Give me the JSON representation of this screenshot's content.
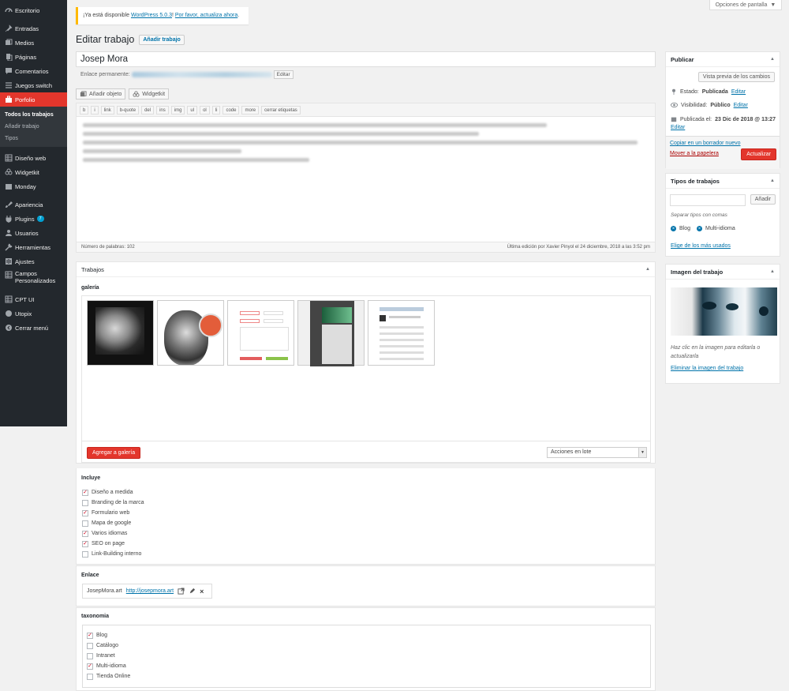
{
  "sidebar": {
    "items": [
      {
        "label": "Escritorio",
        "icon": "dashboard-icon"
      },
      {
        "label": "Entradas",
        "icon": "pin-icon"
      },
      {
        "label": "Medios",
        "icon": "media-icon"
      },
      {
        "label": "Páginas",
        "icon": "page-icon"
      },
      {
        "label": "Comentarios",
        "icon": "comment-icon"
      },
      {
        "label": "Juegos switch",
        "icon": "list-icon"
      },
      {
        "label": "Porfolio",
        "icon": "portfolio-icon"
      },
      {
        "label": "Diseño web",
        "icon": "grid-icon"
      },
      {
        "label": "Widgetkit",
        "icon": "widgetkit-icon"
      },
      {
        "label": "Monday",
        "icon": "calendar-icon"
      },
      {
        "label": "Apariencia",
        "icon": "brush-icon"
      },
      {
        "label": "Plugins",
        "icon": "plug-icon",
        "badge": "7"
      },
      {
        "label": "Usuarios",
        "icon": "user-icon"
      },
      {
        "label": "Herramientas",
        "icon": "wrench-icon"
      },
      {
        "label": "Ajustes",
        "icon": "settings-icon"
      },
      {
        "label": "Campos Personalizados",
        "icon": "grid-icon"
      },
      {
        "label": "CPT UI",
        "icon": "grid-icon"
      },
      {
        "label": "Utopix",
        "icon": "globe-icon"
      },
      {
        "label": "Cerrar menú",
        "icon": "collapse-icon"
      }
    ],
    "submenu": [
      "Todos los trabajos",
      "Añadir trabajo",
      "Tipos"
    ]
  },
  "screen_options": "Opciones de pantalla",
  "notice": {
    "prefix": "¡Ya está disponible ",
    "link1": "WordPress 5.0.3",
    "middle": "! ",
    "link2": "Por favor, actualiza ahora",
    "suffix": "."
  },
  "page": {
    "title": "Editar trabajo",
    "add_new": "Añadir trabajo"
  },
  "post": {
    "title": "Josep Mora",
    "permalink_label": "Enlace permanente:",
    "permalink_edit": "Editar"
  },
  "editor": {
    "add_media": "Añadir objeto",
    "widgetkit": "Widgetkit",
    "quicktags": [
      "b",
      "i",
      "link",
      "b-quote",
      "del",
      "ins",
      "img",
      "ul",
      "ol",
      "li",
      "code",
      "more",
      "cerrar etiquetas"
    ],
    "word_count": "Número de palabras: 102",
    "last_edit": "Última edición por Xavier Pinyol el 24 diciembre, 2018 a las 3:52 pm"
  },
  "publish": {
    "title": "Publicar",
    "preview": "Vista previa de los cambios",
    "status_label": "Estado:",
    "status_value": "Publicada",
    "visibility_label": "Visibilidad:",
    "visibility_value": "Público",
    "published_label": "Publicada el:",
    "published_value": "23 Dic de 2018 @ 13:27",
    "edit": "Editar",
    "copy_draft": "Copiar en un borrador nuevo",
    "trash": "Mover a la papelera",
    "update": "Actualizar"
  },
  "types_box": {
    "title": "Tipos de trabajos",
    "add": "Añadir",
    "hint": "Separar tipos con comas",
    "tags": [
      "Blog",
      "Multi-idioma"
    ],
    "choose": "Elige de los más usados"
  },
  "image_box": {
    "title": "Imagen del trabajo",
    "hint": "Haz clic en la imagen para editarla o actualizarla",
    "remove": "Eliminar la imagen del trabajo"
  },
  "trabajos": {
    "title": "Trabajos",
    "gallery_label": "galería",
    "add_gallery": "Agregar a galería",
    "bulk_actions": "Acciones en lote"
  },
  "incluye": {
    "title": "Incluye",
    "options": [
      {
        "label": "Diseño a medida",
        "checked": true
      },
      {
        "label": "Branding de la marca",
        "checked": false
      },
      {
        "label": "Formulario web",
        "checked": true
      },
      {
        "label": "Mapa de google",
        "checked": false
      },
      {
        "label": "Varios idiomas",
        "checked": true
      },
      {
        "label": "SEO on page",
        "checked": true
      },
      {
        "label": "Link-Building interno",
        "checked": false
      }
    ]
  },
  "enlace": {
    "title": "Enlace",
    "name": "JosepMora.art",
    "url": "http://josepmora.art"
  },
  "taxonomia": {
    "title": "taxonomia",
    "options": [
      {
        "label": "Blog",
        "checked": true
      },
      {
        "label": "Catálogo",
        "checked": false
      },
      {
        "label": "Intranet",
        "checked": false
      },
      {
        "label": "Multi-idioma",
        "checked": true
      },
      {
        "label": "Tienda Online",
        "checked": false
      }
    ]
  },
  "colors": {
    "accent": "#0073aa",
    "active_menu": "#e3362c",
    "sidebar_bg": "#23282d",
    "notice_border": "#ffb900"
  }
}
